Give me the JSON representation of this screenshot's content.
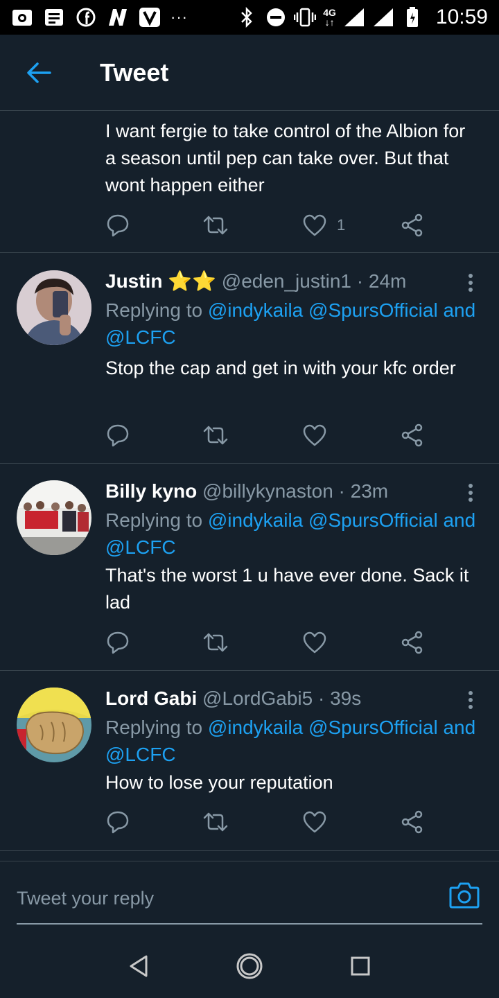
{
  "status_bar": {
    "time": "10:59",
    "network": "4G",
    "overflow": "···",
    "icons": [
      "camera-app-icon",
      "message-icon",
      "facebook-icon",
      "n-app-icon",
      "v-app-icon",
      "bluetooth-icon",
      "do-not-disturb-icon",
      "vibrate-icon",
      "signal-icon",
      "battery-icon"
    ]
  },
  "header": {
    "title": "Tweet"
  },
  "colors": {
    "background": "#15202b",
    "accent": "#1da1f2",
    "muted": "#8899a6",
    "divider": "#38444d"
  },
  "partial_tweet": {
    "text": "I want fergie to take control of the Albion for a season until pep can take over. But that wont happen either",
    "like_count": "1"
  },
  "replies": [
    {
      "name": "Justin",
      "badge": "⭐⭐",
      "handle": "@eden_justin1 · 24m",
      "replying_prefix": "Replying to",
      "mention1": "@indykaila",
      "mention2": "@SpursOfficial",
      "and": "and",
      "mention3": "@LCFC",
      "text": "Stop the cap and get in with your kfc order"
    },
    {
      "name": "Billy kyno",
      "handle": "@billykynaston · 23m",
      "replying_prefix": "Replying to",
      "mention1": "@indykaila",
      "mention2": "@SpursOfficial",
      "and": "and",
      "mention3": "@LCFC",
      "text": "That's the worst 1 u have ever done. Sack it lad"
    },
    {
      "name": "Lord Gabi",
      "handle": "@LordGabi5 · 39s",
      "replying_prefix": "Replying to",
      "mention1": "@indykaila",
      "mention2": "@SpursOfficial",
      "and": "and",
      "mention3": "@LCFC",
      "text": "How to lose your reputation"
    }
  ],
  "reply_bar": {
    "placeholder": "Tweet your reply"
  }
}
